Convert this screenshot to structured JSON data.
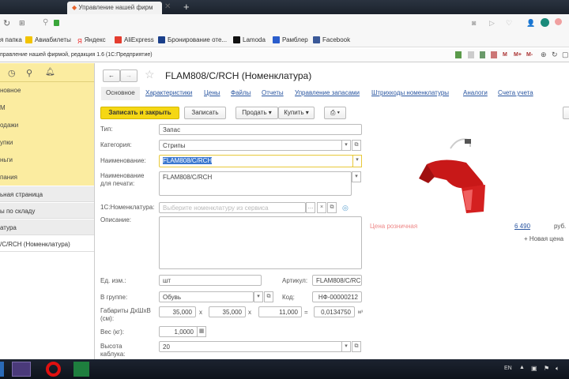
{
  "browser": {
    "tab_title": "Управление нашей фирм",
    "bookmarks": [
      "я папка",
      "Авиабилеты",
      "Яндекс",
      "AliExpress",
      "Бронирование оте...",
      "Lamoda",
      "Рамблер",
      "Facebook"
    ]
  },
  "app": {
    "title": "правление нашей фирмой, редакция 1.6   (1С:Предприятие)",
    "toolbar_right": [
      "M",
      "M+",
      "M-"
    ]
  },
  "sidebar": {
    "sections": [
      "новное",
      "M",
      "одажи",
      "упки",
      "ньги",
      "пания"
    ],
    "items": [
      "ьная страница",
      "ы по складу",
      "атура",
      "/C/RCH (Номенклатура)"
    ]
  },
  "form": {
    "title": "FLAM808/C/RCH (Номенклатура)",
    "tabs": [
      "Основное",
      "Характеристики",
      "Цены",
      "Файлы",
      "Отчеты",
      "Управление запасами",
      "Штрихкоды номенклатуры",
      "Аналоги",
      "Счета учета"
    ],
    "buttons": {
      "save_close": "Записать и закрыть",
      "save": "Записать",
      "sell": "Продать",
      "buy": "Купить"
    },
    "fields": {
      "type_label": "Тип:",
      "type": "Запас",
      "category_label": "Категория:",
      "category": "Стрипы",
      "name_label": "Наименование:",
      "name": "FLAM808/C/RCH",
      "print_name_label": "Наименование для печати:",
      "print_name": "FLAM808/C/RCH",
      "nom1c_label": "1С:Номенклатура:",
      "nom1c_placeholder": "Выберите номенклатуру из сервиса",
      "desc_label": "Описание:",
      "unit_label": "Ед. изм.:",
      "unit": "шт",
      "article_label": "Артикул:",
      "article": "FLAM808/C/RC",
      "group_label": "В группе:",
      "group": "Обувь",
      "code_label": "Код:",
      "code": "НФ-00000212",
      "dims_label": "Габариты ДхШхВ (см):",
      "d": "35,000",
      "w": "35,000",
      "h": "11,000",
      "vol": "0,0134750",
      "vol_unit": "м³",
      "weight_label": "Вес (кг):",
      "weight": "1,0000",
      "heel_label": "Высота каблука:",
      "heel": "20"
    },
    "price": {
      "label": "Цена розничная",
      "value": "6 490",
      "currency": "руб.",
      "new_price": "+ Новая цена"
    }
  },
  "taskbar": {
    "lang": "EN"
  }
}
